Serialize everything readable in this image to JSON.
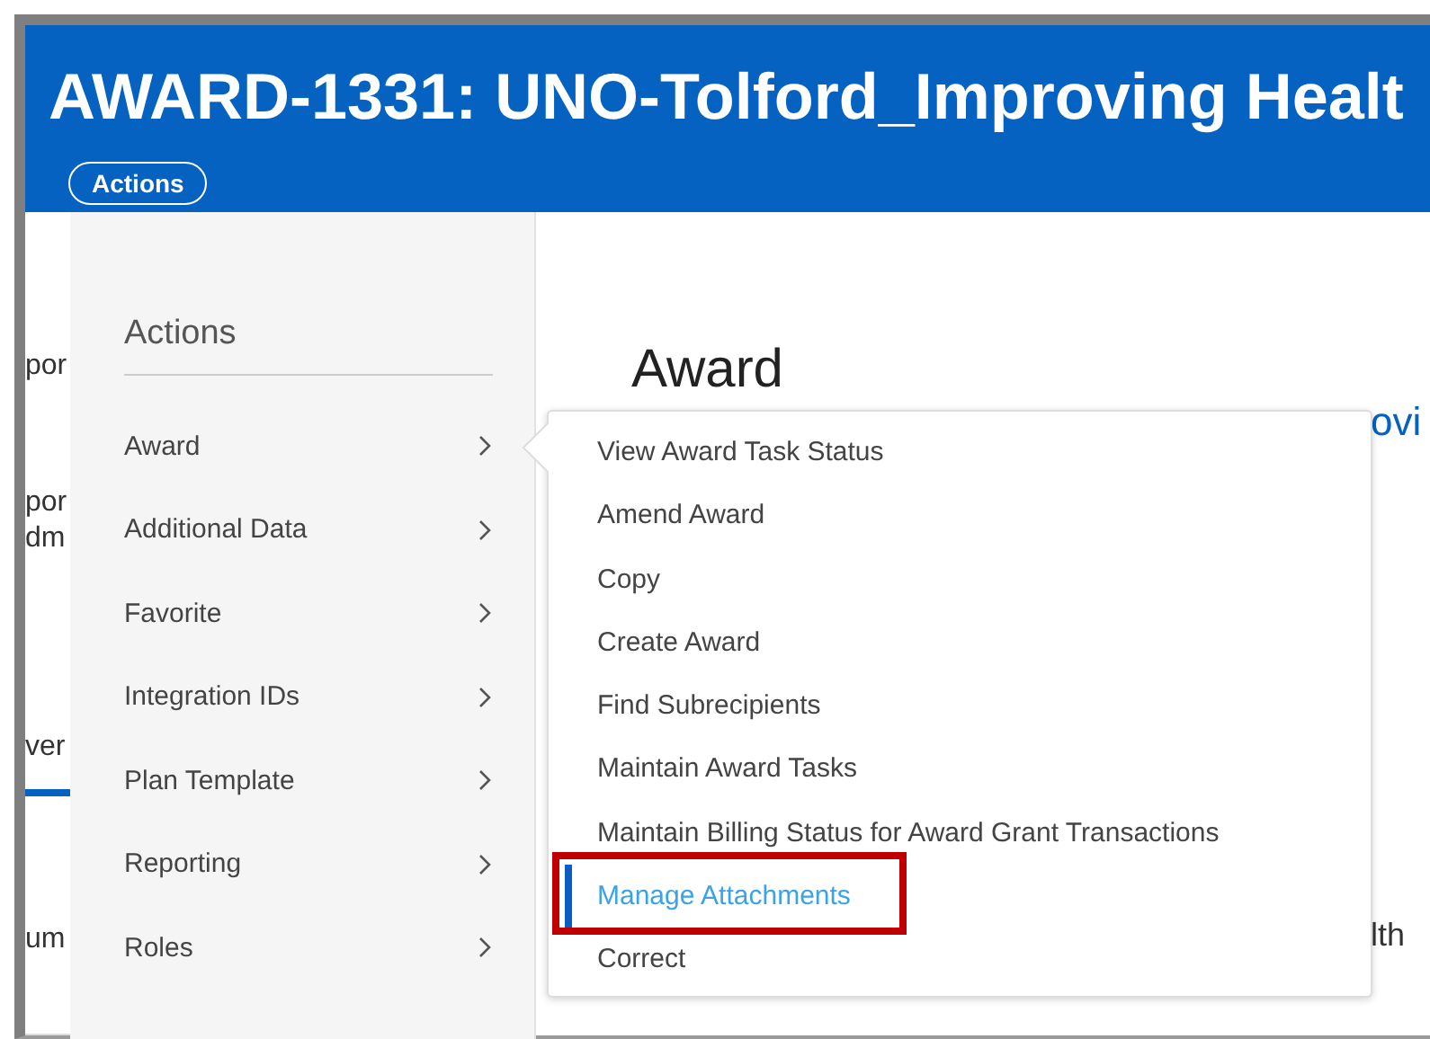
{
  "window": {
    "title": "AWARD-1331: UNO-Tolford_Improving Healt"
  },
  "actions_button": {
    "label": "Actions"
  },
  "background": {
    "left_fragments": [
      {
        "text": "por",
        "kind": "text"
      },
      {
        "text": "por",
        "kind": "text"
      },
      {
        "text": "dm",
        "kind": "text"
      },
      {
        "text": "ver",
        "kind": "tab",
        "selected": true
      },
      {
        "text": "um",
        "kind": "text"
      }
    ],
    "heading": "Award",
    "right_fragments": [
      {
        "text": "ovi",
        "kind": "link"
      },
      {
        "text": "lth",
        "kind": "text"
      }
    ]
  },
  "actions_menu": {
    "title": "Actions",
    "items": [
      {
        "label": "Award"
      },
      {
        "label": "Additional Data"
      },
      {
        "label": "Favorite"
      },
      {
        "label": "Integration IDs"
      },
      {
        "label": "Plan Template"
      },
      {
        "label": "Reporting"
      },
      {
        "label": "Roles"
      }
    ]
  },
  "submenu": {
    "items": [
      {
        "label": "View Award Task Status",
        "selected": false,
        "highlighted": false
      },
      {
        "label": "Amend Award",
        "selected": false,
        "highlighted": false
      },
      {
        "label": "Copy",
        "selected": false,
        "highlighted": false
      },
      {
        "label": "Create Award",
        "selected": false,
        "highlighted": false
      },
      {
        "label": "Find Subrecipients",
        "selected": false,
        "highlighted": false
      },
      {
        "label": "Maintain Award Tasks",
        "selected": false,
        "highlighted": false
      },
      {
        "label": "Maintain Billing Status for Award Grant Transactions",
        "selected": false,
        "highlighted": false
      },
      {
        "label": "Manage Attachments",
        "selected": true,
        "highlighted": true
      },
      {
        "label": "Correct",
        "selected": false,
        "highlighted": false
      }
    ]
  }
}
